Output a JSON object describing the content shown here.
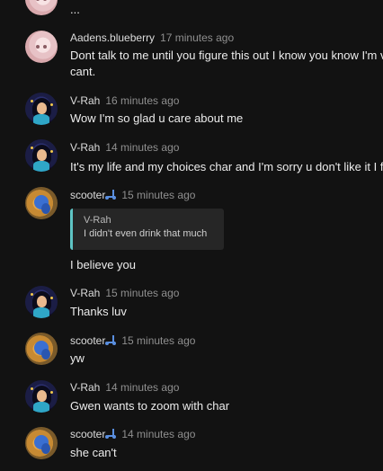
{
  "messages": [
    {
      "user": "",
      "time": "",
      "text": "...",
      "avatar": "pink-avatar"
    },
    {
      "user": "Aadens.blueberry",
      "time": "17 minutes ago",
      "text": "Dont talk to me until you figure this out I know you know I'm ve",
      "text2": "cant.",
      "avatar": "pink-avatar"
    },
    {
      "user": "V-Rah",
      "time": "16 minutes ago",
      "text": "Wow I'm so glad u care about me",
      "avatar": "vrah-avatar"
    },
    {
      "user": "V-Rah",
      "time": "14 minutes ago",
      "text": "It's my life and my choices char and I'm sorry u don't like it I for",
      "avatar": "vrah-avatar"
    },
    {
      "user": "scooter",
      "time": "15 minutes ago",
      "quote_author": "V-Rah",
      "quote_text": "I didn't even drink that much",
      "text": "I believe you",
      "avatar": "scooter-avatar"
    },
    {
      "user": "V-Rah",
      "time": "15 minutes ago",
      "text": "Thanks luv",
      "avatar": "vrah-avatar"
    },
    {
      "user": "scooter",
      "time": "15 minutes ago",
      "text": "yw",
      "avatar": "scooter-avatar"
    },
    {
      "user": "V-Rah",
      "time": "14 minutes ago",
      "text": "Gwen wants to zoom with char",
      "avatar": "vrah-avatar"
    },
    {
      "user": "scooter",
      "time": "14 minutes ago",
      "text": "she can't",
      "avatar": "scooter-avatar"
    }
  ],
  "colors": {
    "background": "#121212",
    "quote_accent": "#5ec4c4",
    "timestamp": "#8f8f8f"
  }
}
